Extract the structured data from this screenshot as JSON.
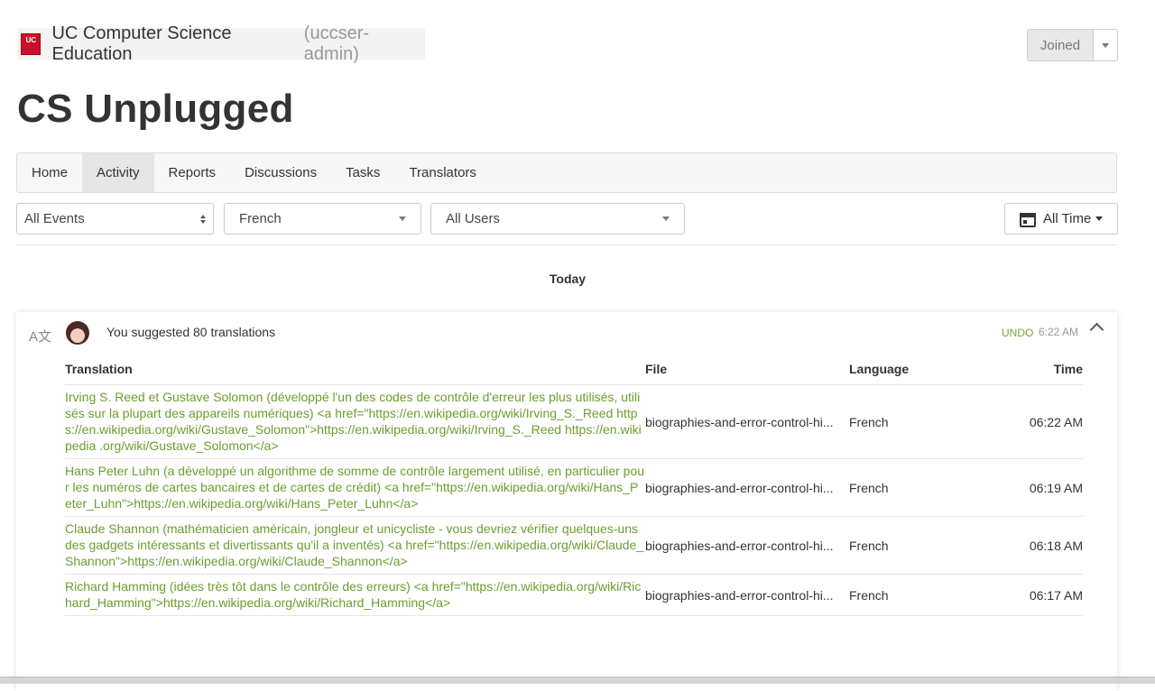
{
  "org": {
    "logo_text": "UC",
    "name": "UC Computer Science Education",
    "handle": "(uccser-admin)"
  },
  "joined_label": "Joined",
  "project_title": "CS Unplugged",
  "nav": [
    {
      "label": "Home",
      "active": false
    },
    {
      "label": "Activity",
      "active": true
    },
    {
      "label": "Reports",
      "active": false
    },
    {
      "label": "Discussions",
      "active": false
    },
    {
      "label": "Tasks",
      "active": false
    },
    {
      "label": "Translators",
      "active": false
    }
  ],
  "filters": {
    "events": "All Events",
    "language": "French",
    "users": "All Users",
    "time": "All Time"
  },
  "section_label": "Today",
  "event": {
    "icon": "translate-icon",
    "summary": "You suggested 80 translations",
    "undo": "UNDO",
    "time": "6:22 AM",
    "columns": {
      "translation": "Translation",
      "file": "File",
      "language": "Language",
      "time": "Time"
    },
    "rows": [
      {
        "translation": "Irving S. Reed et Gustave Solomon (développé l'un des codes de contrôle d'erreur les plus utilisés, utilisés sur la plupart des appareils numériques) <a href=\"https://en.wikipedia.org/wiki/Irving_S._Reed https://en.wikipedia.org/wiki/Gustave_Solomon\">https://en.wikipedia.org/wiki/Irving_S._Reed https://en.wikipedia .org/wiki/Gustave_Solomon</a>",
        "file": "biographies-and-error-control-hi...",
        "language": "French",
        "time": "06:22 AM"
      },
      {
        "translation": "Hans Peter Luhn (a développé un algorithme de somme de contrôle largement utilisé, en particulier pour les numéros de cartes bancaires et de cartes de crédit) <a href=\"https://en.wikipedia.org/wiki/Hans_Peter_Luhn\">https://en.wikipedia.org/wiki/Hans_Peter_Luhn</a>",
        "file": "biographies-and-error-control-hi...",
        "language": "French",
        "time": "06:19 AM"
      },
      {
        "translation": "Claude Shannon (mathématicien américain, jongleur et unicycliste - vous devriez vérifier quelques-uns des gadgets intéressants et divertissants qu'il a inventés) <a href=\"https://en.wikipedia.org/wiki/Claude_Shannon\">https://en.wikipedia.org/wiki/Claude_Shannon</a>",
        "file": "biographies-and-error-control-hi...",
        "language": "French",
        "time": "06:18 AM"
      },
      {
        "translation": "Richard Hamming (idées très tôt dans le contrôle des erreurs) <a href=\"https://en.wikipedia.org/wiki/Richard_Hamming\">https://en.wikipedia.org/wiki/Richard_Hamming</a>",
        "file": "biographies-and-error-control-hi...",
        "language": "French",
        "time": "06:17 AM"
      }
    ]
  },
  "colors": {
    "accent_green": "#6e9c2f",
    "undo_green": "#7aa33b",
    "logo_red": "#c8102e"
  }
}
